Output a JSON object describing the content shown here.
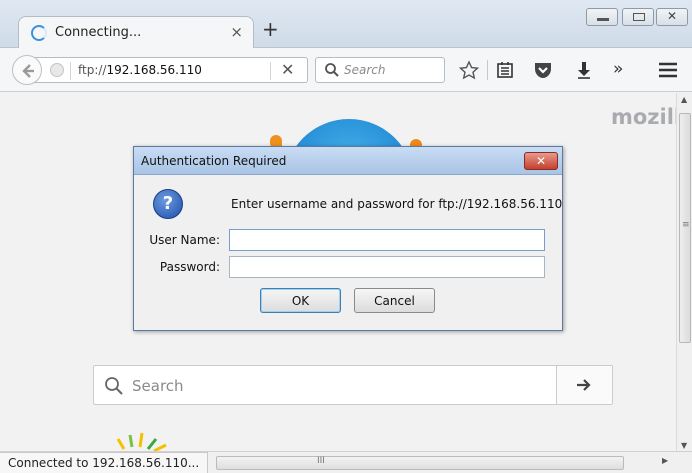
{
  "tab": {
    "title": "Connecting...",
    "close_glyph": "×",
    "new_tab_glyph": "+"
  },
  "window_controls": {
    "close_glyph": "✕"
  },
  "navbar": {
    "url_scheme": "ftp://",
    "url_host": "192.168.56.110",
    "stop_glyph": "✕",
    "search_placeholder": "Search",
    "overflow_glyph": "»"
  },
  "content": {
    "brand_mark": "mozilla",
    "search_placeholder": "Search"
  },
  "dialog": {
    "title": "Authentication Required",
    "close_glyph": "✕",
    "help_glyph": "?",
    "message": "Enter username and password for ftp://192.168.56.110",
    "username_label": "User Name:",
    "username_value": "",
    "password_label": "Password:",
    "password_value": "",
    "ok_label": "OK",
    "cancel_label": "Cancel"
  },
  "status": {
    "text": "Connected to 192.168.56.110..."
  },
  "scrollbars": {
    "grip_v": "≡",
    "grip_h": "III",
    "up": "▲",
    "down": "▼",
    "right": "▶"
  },
  "colors": {
    "accent": "#1b7fd0",
    "dialog_close": "#c5402e",
    "help_icon": "#1d4ea8"
  },
  "icons": [
    "loading-spinner-icon",
    "back-arrow-icon",
    "globe-icon",
    "search-icon",
    "star-icon",
    "reading-list-icon",
    "pocket-icon",
    "download-icon",
    "overflow-icon",
    "hamburger-menu-icon",
    "help-icon",
    "arrow-right-icon"
  ]
}
